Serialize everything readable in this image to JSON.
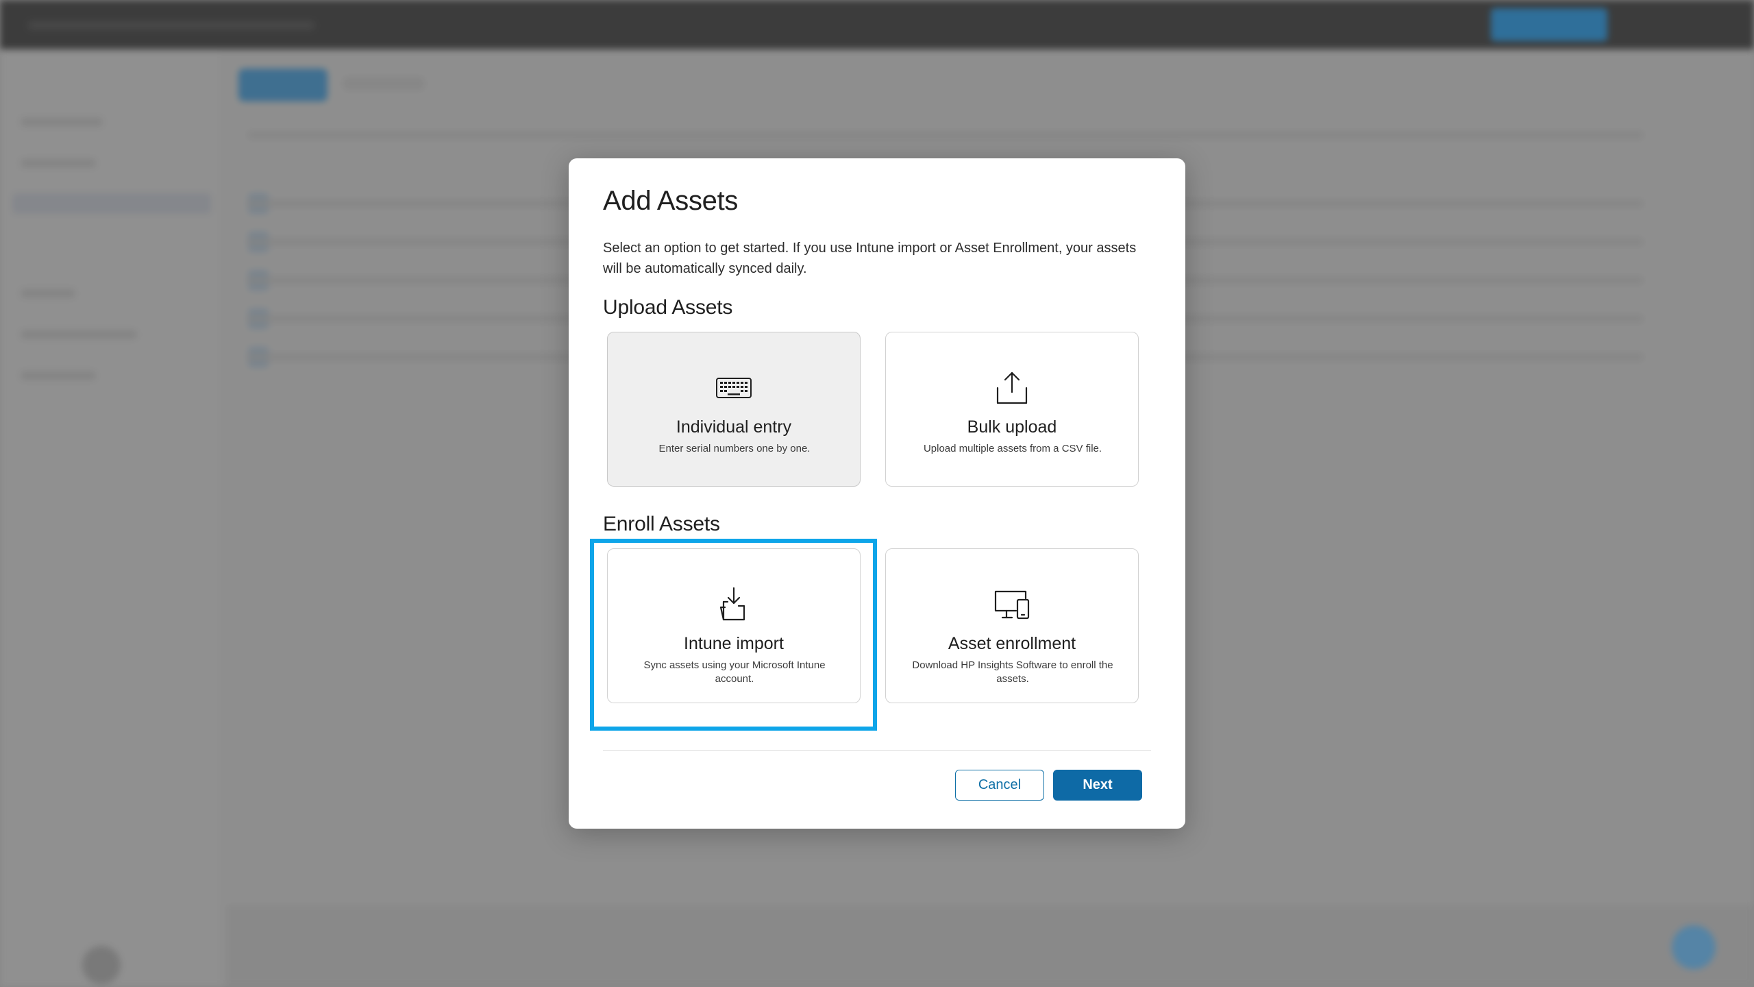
{
  "modal": {
    "title": "Add Assets",
    "description": "Select an option to get started. If you use Intune import or Asset Enrollment, your assets will be automatically synced daily.",
    "upload_section": {
      "title": "Upload Assets",
      "options": [
        {
          "title": "Individual entry",
          "subtitle": "Enter serial numbers one by one.",
          "icon": "keyboard-icon",
          "selected": true
        },
        {
          "title": "Bulk upload",
          "subtitle": "Upload multiple assets from a CSV file.",
          "icon": "upload-icon",
          "selected": false
        }
      ]
    },
    "enroll_section": {
      "title": "Enroll Assets",
      "options": [
        {
          "title": "Intune import",
          "subtitle": "Sync assets using your Microsoft Intune account.",
          "icon": "download-tray-icon",
          "highlighted": true
        },
        {
          "title": "Asset enrollment",
          "subtitle": "Download HP Insights Software to enroll the assets.",
          "icon": "devices-icon",
          "highlighted": false
        }
      ]
    },
    "buttons": {
      "cancel": "Cancel",
      "next": "Next"
    }
  },
  "colors": {
    "primary": "#0e6aa6",
    "highlight": "#0ea5e9",
    "selected_card_bg": "#efefef"
  }
}
